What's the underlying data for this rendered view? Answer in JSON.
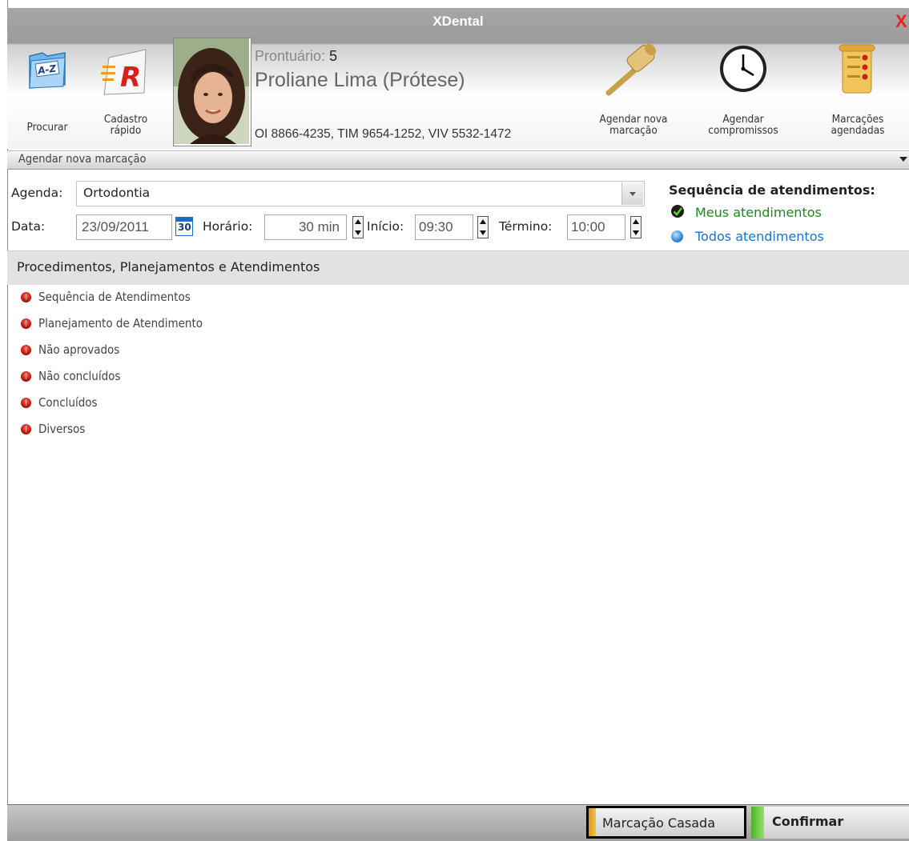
{
  "window": {
    "title": "XDental",
    "close_label": "X"
  },
  "toolbar": {
    "procurar": "Procurar",
    "cadastro_rapido_line1": "Cadastro",
    "cadastro_rapido_line2": "rápido",
    "agendar_nova_line1": "Agendar nova",
    "agendar_nova_line2": "marcação",
    "agendar_compromissos_line1": "Agendar",
    "agendar_compromissos_line2": "compromissos",
    "marcacoes_line1": "Marcações",
    "marcacoes_line2": "agendadas"
  },
  "patient": {
    "prontuario_label": "Prontuário:",
    "prontuario_number": "5",
    "name": "Proliane Lima (Prótese)",
    "phones": "OI 8866-4235, TIM 9654-1252, VIV 5532-1472"
  },
  "section": {
    "title": "Agendar nova marcação"
  },
  "form": {
    "agenda_label": "Agenda:",
    "agenda_value": "Ortodontia",
    "data_label": "Data:",
    "data_value": "23/09/2011",
    "calendar_day": "30",
    "horario_label": "Horário:",
    "horario_value": "30 min",
    "inicio_label": "Início:",
    "inicio_value": "09:30",
    "termino_label": "Término:",
    "termino_value": "10:00"
  },
  "sequencia": {
    "title": "Sequência de atendimentos:",
    "meus": "Meus atendimentos",
    "todos": "Todos atendimentos",
    "colors": {
      "meus": "#1a8a1a",
      "todos": "#1e73c8"
    }
  },
  "procedures": {
    "header": "Procedimentos, Planejamentos e Atendimentos",
    "items": [
      "Sequência de Atendimentos",
      "Planejamento de Atendimento",
      "Não aprovados",
      "Não concluídos",
      "Concluídos",
      "Diversos"
    ]
  },
  "footer": {
    "marcacao_casada": "Marcação Casada",
    "confirmar": "Confirmar"
  }
}
